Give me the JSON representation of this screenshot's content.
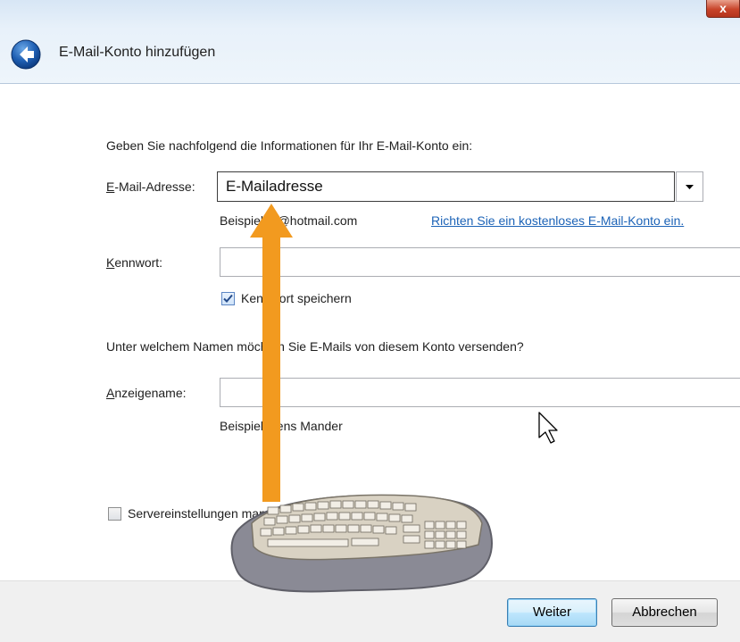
{
  "window": {
    "title": "E-Mail-Konto hinzufügen",
    "close_glyph": "x"
  },
  "form": {
    "intro": "Geben Sie nachfolgend die Informationen für Ihr E-Mail-Konto ein:",
    "email": {
      "label": "E-Mail-Adresse:",
      "value": "E-Mailadresse",
      "example": "Beispiel: 5@hotmail.com",
      "signup_link": "Richten Sie ein kostenloses E-Mail-Konto ein."
    },
    "password": {
      "label": "Kennwort:",
      "value": "",
      "remember_label": "Kennwort speichern",
      "remember_checked": true
    },
    "sender_question": "Unter welchem Namen möchten Sie E-Mails von diesem Konto versenden?",
    "display_name": {
      "label": "Anzeigename:",
      "value": "",
      "example": "Beispiel: Jens Mander"
    },
    "manual_server": {
      "label": "Servereinstellungen manuell konfigurieren.",
      "checked": false
    }
  },
  "buttons": {
    "next": "Weiter",
    "cancel": "Abbrechen"
  },
  "overlay": {
    "arrow_color": "#f29a1f",
    "illustration": "keyboard-illustration"
  },
  "colors": {
    "link": "#1c63b7",
    "titlebar": "#e8f1fa",
    "close_button": "#c8442a"
  }
}
